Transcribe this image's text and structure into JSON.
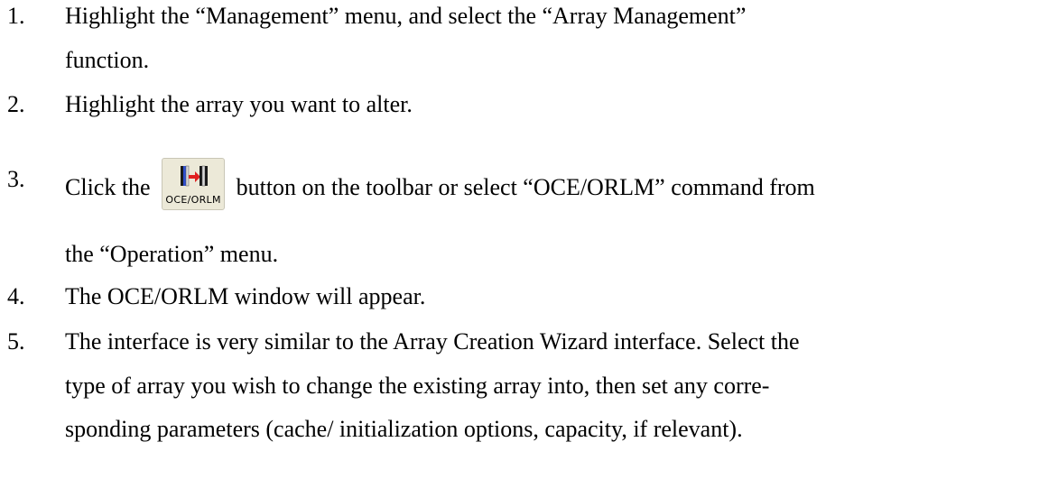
{
  "steps": [
    {
      "number": "1.",
      "lines": [
        "Highlight the “Management” menu, and select the “Array Management”",
        "function."
      ]
    },
    {
      "number": "2.",
      "lines": [
        "Highlight the array you want to alter."
      ]
    },
    {
      "number": "3.",
      "before_button": "Click the",
      "after_button": "button on the toolbar or select “OCE/ORLM” command from",
      "line2": "the “Operation” menu."
    },
    {
      "number": "4.",
      "lines": [
        "The OCE/ORLM window will appear."
      ]
    },
    {
      "number": "5.",
      "lines": [
        "The interface is very similar to the Array Creation Wizard interface.  Select the",
        "type of array you wish to change the existing array into, then set any corre-",
        "sponding parameters (cache/ initialization options, capacity, if relevant)."
      ]
    }
  ],
  "toolbar_button": {
    "caption": "OCE/ORLM",
    "icon": "oce-orlm-icon",
    "colors": {
      "face": "#ece9d8",
      "arrow": "#e02020",
      "drive_blue": "#2f4fd0",
      "drive_dark": "#1a1a1a"
    }
  }
}
